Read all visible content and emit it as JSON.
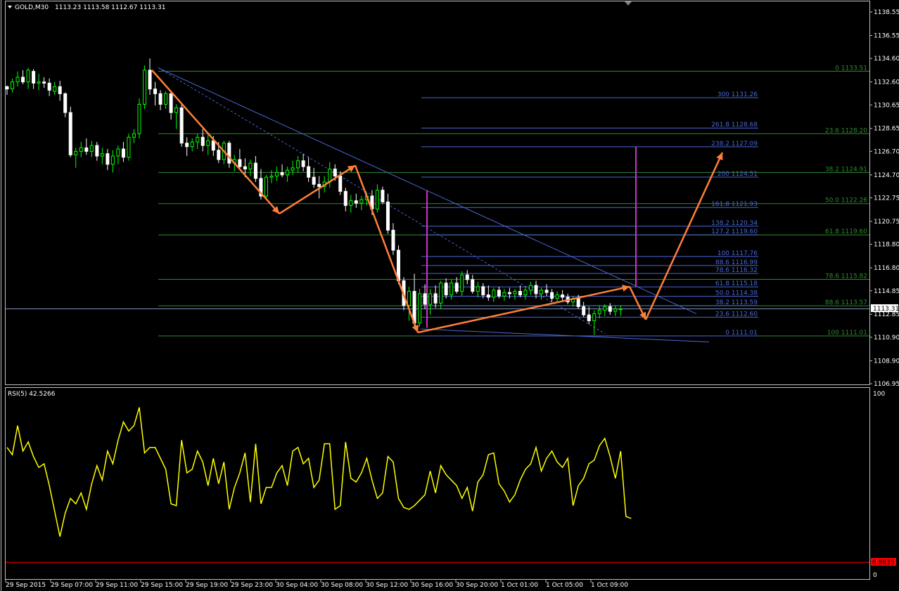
{
  "header": {
    "symbol_label": "GOLD,M30",
    "ohlc": "1113.23 1113.58 1112.67 1113.31"
  },
  "rsi_header": "RSI(5) 42.5266",
  "price_axis": {
    "ticks": [
      "1138.55",
      "1136.55",
      "1134.60",
      "1132.60",
      "1130.65",
      "1128.65",
      "1126.70",
      "1124.70",
      "1122.75",
      "1120.75",
      "1118.80",
      "1116.80",
      "1114.85",
      "1112.85",
      "1110.90",
      "1108.90",
      "1106.95"
    ],
    "current_price": "1113.31"
  },
  "rsi_axis": {
    "top": "100",
    "bottom": "0",
    "level_label": "6.8635"
  },
  "time_axis": [
    "29 Sep 2015",
    "29 Sep 07:00",
    "29 Sep 11:00",
    "29 Sep 15:00",
    "29 Sep 19:00",
    "29 Sep 23:00",
    "30 Sep 04:00",
    "30 Sep 08:00",
    "30 Sep 12:00",
    "30 Sep 16:00",
    "30 Sep 20:00",
    "1 Oct 01:00",
    "1 Oct 05:00",
    "1 Oct 09:00"
  ],
  "fib_extension_labels": [
    "300 1131.26",
    "261.8 1128.68",
    "238.2 1127.09",
    "200 1124.51",
    "161.8 1121.93",
    "138.2 1120.34",
    "127.2 1119.60",
    "100 1117.76",
    "88.6 1116.99",
    "78.6 1116.32",
    "61.8 1115.18",
    "50.0 1114.38",
    "38.2 1113.59",
    "23.6 1112.60",
    "0 1111.01"
  ],
  "fib_retracement_labels": [
    "0 1133.51",
    "23.6 1128.20",
    "38.2 1124.91",
    "50.0 1122.26",
    "61.8 1119.60",
    "78.6 1115.82",
    "88.6 1113.57",
    "100 1111.01"
  ],
  "colors": {
    "background": "#000000",
    "bull_candle": "#00ff00",
    "bear_candle": "#ffffff",
    "rsi_line": "#ffff00",
    "rsi_level": "#ff0000",
    "pattern_arrows": "#ff7f3a",
    "fib_extension": "#4a68d8",
    "fib_retracement": "#2e8b2e",
    "trendline": "#4a68d8",
    "vertical_markers": "#cc33cc",
    "current_price_line": "#7f8fbf"
  },
  "chart_data": {
    "type": "candlestick",
    "symbol": "GOLD",
    "timeframe": "M30",
    "price_range": [
      1106.95,
      1138.55
    ],
    "rsi_period": 5,
    "rsi_range": [
      0,
      100
    ],
    "rsi_level": 6.8635,
    "candles": [
      [
        1132.2,
        1132.3,
        1131.5,
        1132.0
      ],
      [
        1132.0,
        1132.9,
        1131.7,
        1132.6
      ],
      [
        1132.6,
        1133.5,
        1132.2,
        1133.0
      ],
      [
        1133.0,
        1133.6,
        1132.4,
        1132.6
      ],
      [
        1132.6,
        1133.8,
        1132.0,
        1133.6
      ],
      [
        1133.5,
        1133.7,
        1132.0,
        1132.5
      ],
      [
        1132.5,
        1133.3,
        1131.9,
        1132.6
      ],
      [
        1132.6,
        1133.0,
        1132.1,
        1132.5
      ],
      [
        1132.5,
        1132.9,
        1131.4,
        1131.9
      ],
      [
        1131.8,
        1132.6,
        1131.5,
        1132.2
      ],
      [
        1132.2,
        1132.7,
        1131.0,
        1131.6
      ],
      [
        1131.6,
        1131.7,
        1129.6,
        1130.0
      ],
      [
        1130.0,
        1130.5,
        1126.2,
        1126.4
      ],
      [
        1126.4,
        1127.0,
        1125.3,
        1126.7
      ],
      [
        1126.7,
        1127.5,
        1126.2,
        1127.0
      ],
      [
        1127.0,
        1127.8,
        1126.4,
        1126.7
      ],
      [
        1126.7,
        1127.6,
        1126.2,
        1127.2
      ],
      [
        1127.2,
        1127.5,
        1125.9,
        1126.3
      ],
      [
        1126.3,
        1127.0,
        1125.6,
        1126.5
      ],
      [
        1126.5,
        1126.9,
        1125.1,
        1125.6
      ],
      [
        1125.6,
        1126.8,
        1124.9,
        1126.3
      ],
      [
        1126.3,
        1127.2,
        1125.6,
        1126.9
      ],
      [
        1126.9,
        1127.5,
        1125.8,
        1126.2
      ],
      [
        1126.2,
        1128.2,
        1125.9,
        1127.9
      ],
      [
        1127.9,
        1128.6,
        1127.4,
        1128.2
      ],
      [
        1128.2,
        1131.2,
        1127.8,
        1130.7
      ],
      [
        1130.7,
        1134.0,
        1130.3,
        1133.6
      ],
      [
        1133.6,
        1134.6,
        1131.5,
        1132.0
      ],
      [
        1132.0,
        1132.6,
        1130.6,
        1131.6
      ],
      [
        1131.6,
        1131.9,
        1130.2,
        1130.7
      ],
      [
        1130.7,
        1131.8,
        1130.3,
        1131.6
      ],
      [
        1131.6,
        1131.8,
        1129.4,
        1130.0
      ],
      [
        1130.0,
        1130.7,
        1128.6,
        1130.4
      ],
      [
        1130.4,
        1130.8,
        1127.1,
        1127.4
      ],
      [
        1127.4,
        1127.9,
        1126.3,
        1127.1
      ],
      [
        1127.1,
        1127.8,
        1126.7,
        1127.5
      ],
      [
        1127.5,
        1128.2,
        1126.9,
        1127.9
      ],
      [
        1127.9,
        1128.6,
        1126.7,
        1127.2
      ],
      [
        1127.2,
        1128.2,
        1126.4,
        1127.6
      ],
      [
        1127.6,
        1128.0,
        1126.3,
        1126.8
      ],
      [
        1126.8,
        1127.5,
        1125.7,
        1126.0
      ],
      [
        1126.0,
        1127.6,
        1125.6,
        1127.4
      ],
      [
        1127.4,
        1127.6,
        1125.3,
        1125.7
      ],
      [
        1125.7,
        1126.4,
        1125.0,
        1126.0
      ],
      [
        1126.0,
        1126.9,
        1125.3,
        1125.4
      ],
      [
        1125.4,
        1126.1,
        1124.5,
        1125.2
      ],
      [
        1125.2,
        1126.0,
        1124.6,
        1125.7
      ],
      [
        1125.7,
        1126.3,
        1124.1,
        1124.4
      ],
      [
        1124.4,
        1125.2,
        1122.6,
        1122.9
      ],
      [
        1122.9,
        1124.7,
        1122.6,
        1124.5
      ],
      [
        1124.5,
        1125.1,
        1124.0,
        1124.6
      ],
      [
        1124.6,
        1125.4,
        1124.2,
        1124.9
      ],
      [
        1124.9,
        1125.6,
        1124.5,
        1124.7
      ],
      [
        1124.7,
        1125.4,
        1124.1,
        1125.1
      ],
      [
        1125.1,
        1125.9,
        1124.7,
        1125.3
      ],
      [
        1125.3,
        1126.3,
        1124.9,
        1125.9
      ],
      [
        1125.9,
        1126.5,
        1125.0,
        1125.4
      ],
      [
        1125.4,
        1126.2,
        1124.1,
        1124.5
      ],
      [
        1124.5,
        1125.3,
        1123.6,
        1123.9
      ],
      [
        1123.9,
        1124.6,
        1122.7,
        1123.7
      ],
      [
        1123.7,
        1124.6,
        1123.2,
        1124.1
      ],
      [
        1124.1,
        1125.8,
        1123.6,
        1125.2
      ],
      [
        1125.2,
        1125.6,
        1124.2,
        1124.6
      ],
      [
        1124.6,
        1125.0,
        1123.0,
        1123.3
      ],
      [
        1123.3,
        1123.6,
        1121.6,
        1122.1
      ],
      [
        1122.1,
        1123.0,
        1121.5,
        1122.5
      ],
      [
        1122.5,
        1123.1,
        1121.9,
        1122.3
      ],
      [
        1122.3,
        1122.9,
        1121.7,
        1122.6
      ],
      [
        1122.6,
        1123.2,
        1122.1,
        1122.9
      ],
      [
        1122.9,
        1123.4,
        1121.3,
        1121.8
      ],
      [
        1121.8,
        1123.9,
        1121.5,
        1123.4
      ],
      [
        1123.4,
        1123.7,
        1122.2,
        1122.4
      ],
      [
        1122.4,
        1123.1,
        1119.7,
        1120.0
      ],
      [
        1120.0,
        1120.6,
        1117.9,
        1118.3
      ],
      [
        1118.3,
        1118.7,
        1115.4,
        1115.7
      ],
      [
        1115.7,
        1116.0,
        1113.2,
        1113.6
      ],
      [
        1113.6,
        1115.2,
        1112.3,
        1114.8
      ],
      [
        1114.8,
        1116.3,
        1111.6,
        1112.1
      ],
      [
        1112.1,
        1115.0,
        1111.8,
        1114.6
      ],
      [
        1114.6,
        1115.4,
        1113.3,
        1113.7
      ],
      [
        1113.7,
        1115.0,
        1112.8,
        1114.6
      ],
      [
        1114.6,
        1115.3,
        1113.4,
        1113.8
      ],
      [
        1113.8,
        1115.7,
        1113.3,
        1115.5
      ],
      [
        1115.5,
        1115.9,
        1114.2,
        1114.5
      ],
      [
        1114.5,
        1115.8,
        1114.1,
        1115.5
      ],
      [
        1115.5,
        1116.0,
        1114.6,
        1114.8
      ],
      [
        1114.8,
        1116.5,
        1114.4,
        1116.2
      ],
      [
        1116.2,
        1116.6,
        1115.4,
        1115.8
      ],
      [
        1115.8,
        1116.2,
        1114.6,
        1114.8
      ],
      [
        1114.8,
        1115.6,
        1114.3,
        1115.2
      ],
      [
        1115.2,
        1115.5,
        1114.2,
        1114.5
      ],
      [
        1114.5,
        1115.3,
        1114.0,
        1114.3
      ],
      [
        1114.3,
        1115.1,
        1113.9,
        1114.9
      ],
      [
        1114.9,
        1115.2,
        1114.2,
        1114.4
      ],
      [
        1114.4,
        1115.0,
        1114.0,
        1114.7
      ],
      [
        1114.7,
        1115.1,
        1114.2,
        1114.6
      ],
      [
        1114.6,
        1115.0,
        1114.1,
        1114.8
      ],
      [
        1114.8,
        1115.3,
        1114.3,
        1114.5
      ],
      [
        1114.5,
        1115.2,
        1114.1,
        1114.9
      ],
      [
        1114.9,
        1115.6,
        1114.5,
        1115.3
      ],
      [
        1115.3,
        1115.7,
        1114.2,
        1114.6
      ],
      [
        1114.6,
        1115.1,
        1114.1,
        1114.9
      ],
      [
        1114.9,
        1115.4,
        1114.4,
        1114.7
      ],
      [
        1114.7,
        1115.0,
        1113.9,
        1114.2
      ],
      [
        1114.2,
        1114.8,
        1113.8,
        1114.5
      ],
      [
        1114.5,
        1114.9,
        1113.9,
        1114.3
      ],
      [
        1114.3,
        1114.6,
        1113.7,
        1113.9
      ],
      [
        1113.9,
        1114.4,
        1113.5,
        1114.2
      ],
      [
        1114.2,
        1114.5,
        1113.3,
        1113.5
      ],
      [
        1113.5,
        1113.9,
        1112.6,
        1112.8
      ],
      [
        1112.8,
        1113.5,
        1112.0,
        1112.3
      ],
      [
        1112.3,
        1113.2,
        1111.1,
        1112.9
      ],
      [
        1112.9,
        1113.6,
        1112.5,
        1113.2
      ],
      [
        1113.2,
        1113.7,
        1112.7,
        1113.5
      ],
      [
        1113.5,
        1113.8,
        1112.8,
        1113.1
      ],
      [
        1113.1,
        1113.6,
        1112.7,
        1113.3
      ],
      [
        1113.3,
        1113.6,
        1112.7,
        1113.3
      ]
    ],
    "rsi": [
      70,
      66,
      82,
      68,
      73,
      65,
      59,
      61,
      49,
      35,
      21,
      34,
      42,
      39,
      45,
      36,
      50,
      60,
      52,
      68,
      61,
      74,
      84,
      79,
      82,
      92,
      67,
      70,
      70,
      64,
      58,
      39,
      38,
      74,
      56,
      58,
      68,
      62,
      49,
      64,
      50,
      62,
      36,
      48,
      56,
      67,
      40,
      72,
      39,
      48,
      48,
      56,
      60,
      49,
      68,
      70,
      61,
      64,
      48,
      52,
      72,
      72,
      36,
      38,
      73,
      53,
      51,
      56,
      64,
      52,
      42,
      45,
      65,
      62,
      42,
      37,
      36,
      38,
      41,
      44,
      57,
      45,
      60,
      55,
      52,
      49,
      42,
      48,
      35,
      51,
      55,
      66,
      67,
      50,
      46,
      40,
      44,
      52,
      58,
      61,
      70,
      57,
      64,
      68,
      62,
      59,
      64,
      38,
      49,
      53,
      61,
      63,
      71,
      75,
      65,
      53,
      68,
      32,
      31
    ],
    "fib_extension": {
      "levels": [
        {
          "ratio": "300",
          "price": 1131.26
        },
        {
          "ratio": "261.8",
          "price": 1128.68
        },
        {
          "ratio": "238.2",
          "price": 1127.09
        },
        {
          "ratio": "200",
          "price": 1124.51
        },
        {
          "ratio": "161.8",
          "price": 1121.93
        },
        {
          "ratio": "138.2",
          "price": 1120.34
        },
        {
          "ratio": "127.2",
          "price": 1119.6
        },
        {
          "ratio": "100",
          "price": 1117.76
        },
        {
          "ratio": "88.6",
          "price": 1116.99
        },
        {
          "ratio": "78.6",
          "price": 1116.32
        },
        {
          "ratio": "61.8",
          "price": 1115.18
        },
        {
          "ratio": "50.0",
          "price": 1114.38
        },
        {
          "ratio": "38.2",
          "price": 1113.59
        },
        {
          "ratio": "23.6",
          "price": 1112.6
        },
        {
          "ratio": "0",
          "price": 1111.01
        }
      ]
    },
    "fib_retracement": {
      "levels": [
        {
          "ratio": "0",
          "price": 1133.51
        },
        {
          "ratio": "23.6",
          "price": 1128.2
        },
        {
          "ratio": "38.2",
          "price": 1124.91
        },
        {
          "ratio": "50.0",
          "price": 1122.26
        },
        {
          "ratio": "61.8",
          "price": 1119.6
        },
        {
          "ratio": "78.6",
          "price": 1115.82
        },
        {
          "ratio": "88.6",
          "price": 1113.57
        },
        {
          "ratio": "100",
          "price": 1111.01
        }
      ]
    },
    "pattern_path_prices": [
      1133.6,
      1121.4,
      1125.5,
      1111.3,
      1115.2,
      1112.4,
      1126.6
    ],
    "current_price": 1113.31
  }
}
